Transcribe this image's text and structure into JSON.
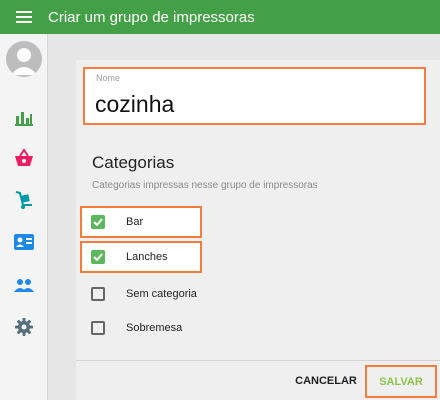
{
  "header": {
    "title": "Criar um grupo de impressoras",
    "background": "#43a047"
  },
  "sidebar": {
    "items": [
      {
        "icon": "bar-chart-icon",
        "color": "#43a047"
      },
      {
        "icon": "basket-icon",
        "color": "#e91e63"
      },
      {
        "icon": "hand-truck-icon",
        "color": "#0097a7"
      },
      {
        "icon": "id-card-icon",
        "color": "#1e88e5"
      },
      {
        "icon": "people-icon",
        "color": "#1e88e5"
      },
      {
        "icon": "gear-icon",
        "color": "#546e7a"
      }
    ]
  },
  "form": {
    "name_label": "Nome",
    "name_value": "cozinha",
    "section_title": "Categorias",
    "section_subtitle": "Categorias impressas nesse grupo de impressoras",
    "categories": [
      {
        "label": "Bar",
        "checked": true
      },
      {
        "label": "Lanches",
        "checked": true
      },
      {
        "label": "Sem categoria",
        "checked": false
      },
      {
        "label": "Sobremesa",
        "checked": false
      }
    ]
  },
  "actions": {
    "cancel_label": "CANCELAR",
    "save_label": "SALVAR"
  },
  "colors": {
    "accent": "#43a047",
    "highlight": "#f47c3c",
    "checkbox": "#5cb85c",
    "save_text": "#8bc34a"
  }
}
